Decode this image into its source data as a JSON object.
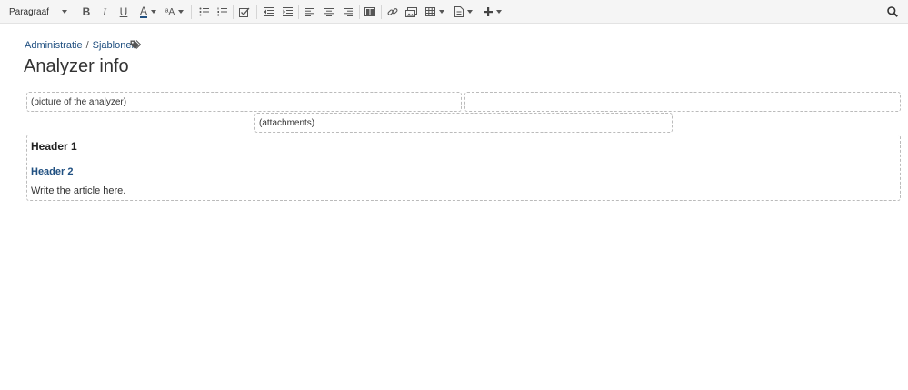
{
  "toolbar": {
    "paragraph_label": "Paragraaf",
    "buttons": [
      {
        "name": "bold-button",
        "glyph": "B"
      },
      {
        "name": "italic-button",
        "glyph": "I"
      },
      {
        "name": "underline-button",
        "glyph": "U"
      },
      {
        "name": "text-color-button",
        "glyph": "A"
      },
      {
        "name": "text-format-button",
        "glyph": "ᵃA"
      }
    ]
  },
  "breadcrumb": {
    "items": [
      "Administratie",
      "Sjablonen"
    ],
    "separator": "/"
  },
  "page": {
    "title": "Analyzer info"
  },
  "layout": {
    "left_cell": "(picture of the analyzer)",
    "right_cell": "",
    "attachments_cell": "(attachments)",
    "header1": "Header 1",
    "header2": "Header 2",
    "body_text": "Write the article here."
  },
  "colors": {
    "link": "#205081",
    "toolbar_bg": "#f5f5f5",
    "text_color_underline": "#205081"
  }
}
